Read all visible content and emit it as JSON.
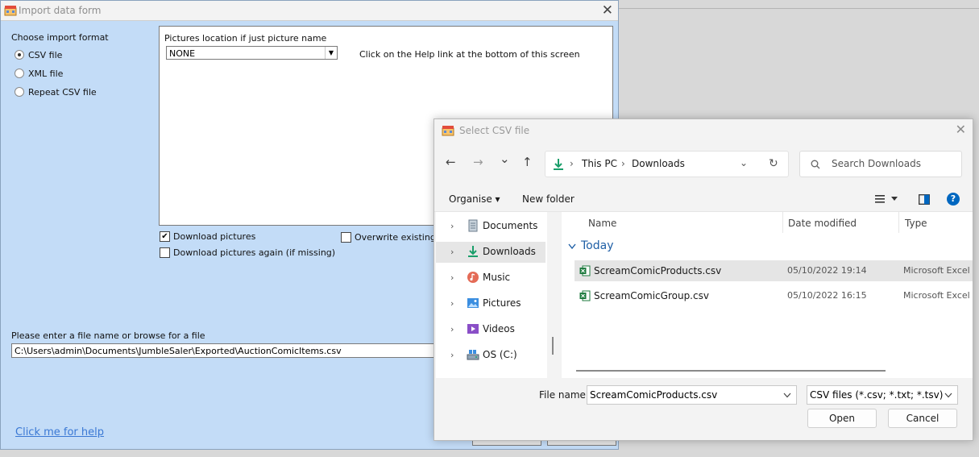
{
  "import_form": {
    "title": "Import data form",
    "close_glyph": "✕",
    "format_heading": "Choose import format",
    "formats": [
      {
        "label": "CSV file",
        "selected": true
      },
      {
        "label": "XML file",
        "selected": false
      },
      {
        "label": "Repeat CSV file",
        "selected": false
      }
    ],
    "pictures_location_label": "Pictures location if just picture name",
    "pictures_location_value": "NONE",
    "help_hint": "Click on the Help link at the bottom of this screen",
    "download_pictures_label": "Download pictures",
    "download_pictures_checked": true,
    "download_again_label": "Download pictures again (if missing)",
    "download_again_checked": false,
    "overwrite_label": "Overwrite existing d",
    "overwrite_checked": false,
    "file_prompt": "Please enter a file name or browse for a file",
    "file_path": "C:\\Users\\admin\\Documents\\JumbleSaler\\Exported\\AuctionComicItems.csv",
    "help_link": "Click me for help"
  },
  "csv_dialog": {
    "title": "Select CSV file",
    "close_glyph": "✕",
    "nav": {
      "back": "←",
      "forward": "→",
      "recent": "⌄",
      "up": "↑",
      "refresh": "↻"
    },
    "breadcrumb": [
      "This PC",
      "Downloads"
    ],
    "breadcrumb_sep": "›",
    "search_placeholder": "Search Downloads",
    "toolbar": {
      "organise": "Organise ▾",
      "new_folder": "New folder",
      "help": "?"
    },
    "nav_pane": [
      {
        "label": "Documents",
        "icon": "documents-icon",
        "selected": false
      },
      {
        "label": "Downloads",
        "icon": "downloads-icon",
        "selected": true
      },
      {
        "label": "Music",
        "icon": "music-icon",
        "selected": false
      },
      {
        "label": "Pictures",
        "icon": "pictures-icon",
        "selected": false
      },
      {
        "label": "Videos",
        "icon": "videos-icon",
        "selected": false
      },
      {
        "label": "OS (C:)",
        "icon": "drive-icon",
        "selected": false
      }
    ],
    "columns": {
      "name": "Name",
      "date": "Date modified",
      "type": "Type"
    },
    "group": "Today",
    "files": [
      {
        "name": "ScreamComicProducts.csv",
        "date": "05/10/2022 19:14",
        "type": "Microsoft Excel",
        "selected": true
      },
      {
        "name": "ScreamComicGroup.csv",
        "date": "05/10/2022 16:15",
        "type": "Microsoft Excel",
        "selected": false
      }
    ],
    "file_name_label": "File name:",
    "file_name_value": "ScreamComicProducts.csv",
    "file_type_value": "CSV files (*.csv; *.txt; *.tsv)",
    "open_label": "Open",
    "cancel_label": "Cancel"
  },
  "colors": {
    "form_bg": "#c3dcf7",
    "link": "#3a78d4",
    "accent": "#0067c0",
    "excel_green": "#1d7a3e"
  }
}
